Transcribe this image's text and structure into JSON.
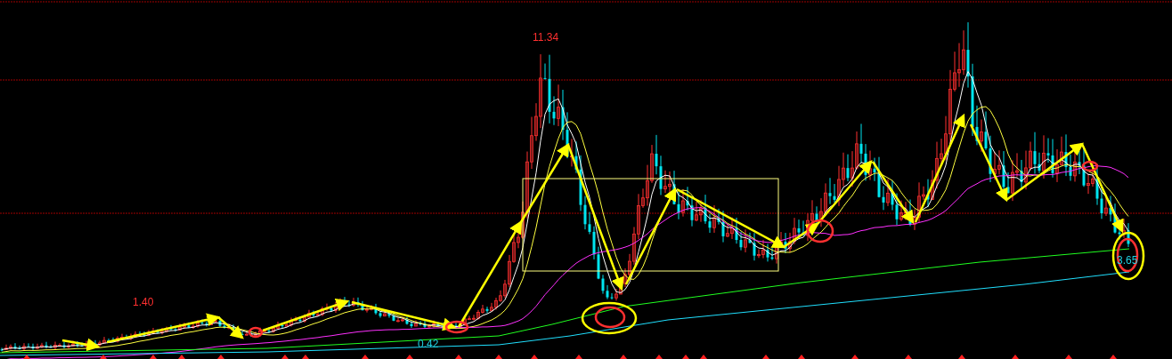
{
  "chart": {
    "price_labels": [
      {
        "kind": "high",
        "text": "11.34"
      },
      {
        "kind": "high",
        "text": "1.40"
      },
      {
        "kind": "low",
        "text": "0.42"
      },
      {
        "kind": "last",
        "text": "3.65"
      }
    ]
  }
}
